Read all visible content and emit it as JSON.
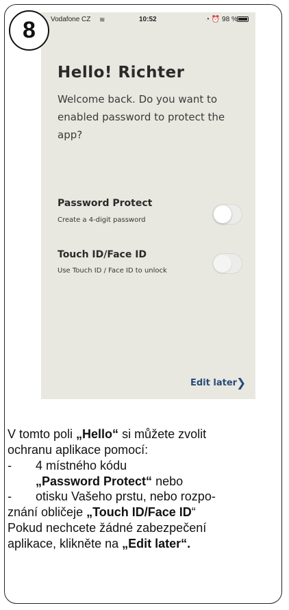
{
  "step": "8",
  "statusbar": {
    "carrier": "Vodafone CZ",
    "wifi": "≋",
    "time": "10:52",
    "right": "◔ ⏰ 98 %"
  },
  "screen": {
    "title": "Hello! Richter",
    "welcome": "Welcome back. Do you want to enabled password to protect the app?",
    "password_title": "Password Protect",
    "password_sub": "Create a 4-digit password",
    "touch_title": "Touch ID/Face ID",
    "touch_sub": "Use Touch ID / Face ID to unlock",
    "edit_later": "Edit later",
    "chevron": "❯"
  },
  "instructions": {
    "l1_a": "V tomto poli ",
    "l1_b": "„Hello“",
    "l1_c": " si můžete zvolit",
    "l2": "ochranu aplikace pomocí:",
    "l3_dash": "-",
    "l3": "4 místného kódu",
    "l4_b": "„Password Protect“",
    "l4_c": " nebo",
    "l5_dash": "-",
    "l5": "otisku Vašeho prstu, nebo rozpo-",
    "l6_a": "znání obličeje ",
    "l6_b": "„Touch ID/Face ID",
    "l6_c": "“",
    "l7": "Pokud nechcete žádné zabezpečení",
    "l8_a": "aplikace, klikněte na ",
    "l8_b": "„Edit later“."
  }
}
